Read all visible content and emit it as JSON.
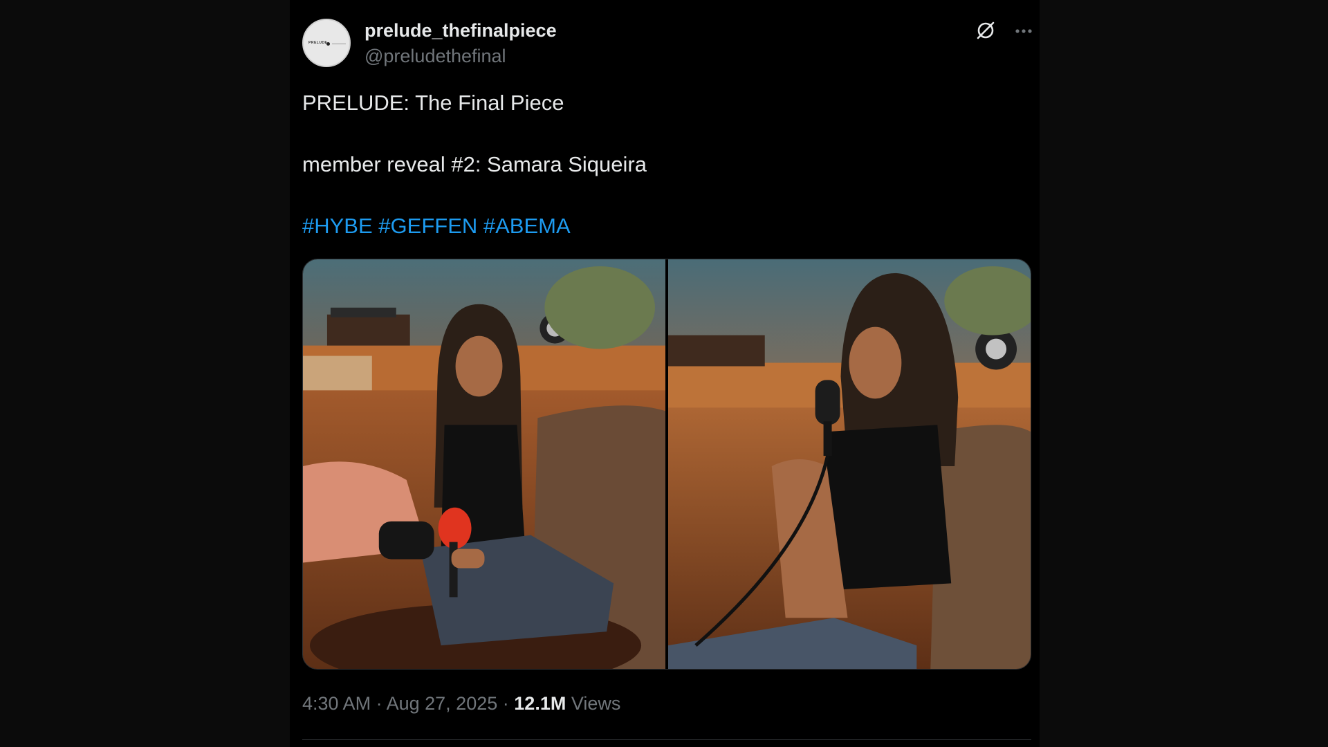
{
  "author": {
    "display_name": "prelude_thefinalpiece",
    "handle": "@preludethefinal",
    "avatar_text": "PRELUDE"
  },
  "post": {
    "line1": "PRELUDE: The Final Piece",
    "line2": "member reveal #2: Samara Siqueira",
    "hashtags": [
      "#HYBE",
      "#GEFFEN",
      "#ABEMA"
    ]
  },
  "media": [
    {
      "icon": "photo-woman-red-microphone-sofa"
    },
    {
      "icon": "photo-woman-black-microphone-sofa"
    }
  ],
  "meta": {
    "time": "4:30 AM",
    "separator": "·",
    "date": "Aug 27, 2025",
    "views_count": "12.1M",
    "views_label": "Views"
  },
  "icons": {
    "grok": "grok-icon",
    "more": "more-icon"
  },
  "colors": {
    "background": "#000000",
    "text": "#e7e9ea",
    "muted": "#71767b",
    "link": "#1d9bf0"
  }
}
